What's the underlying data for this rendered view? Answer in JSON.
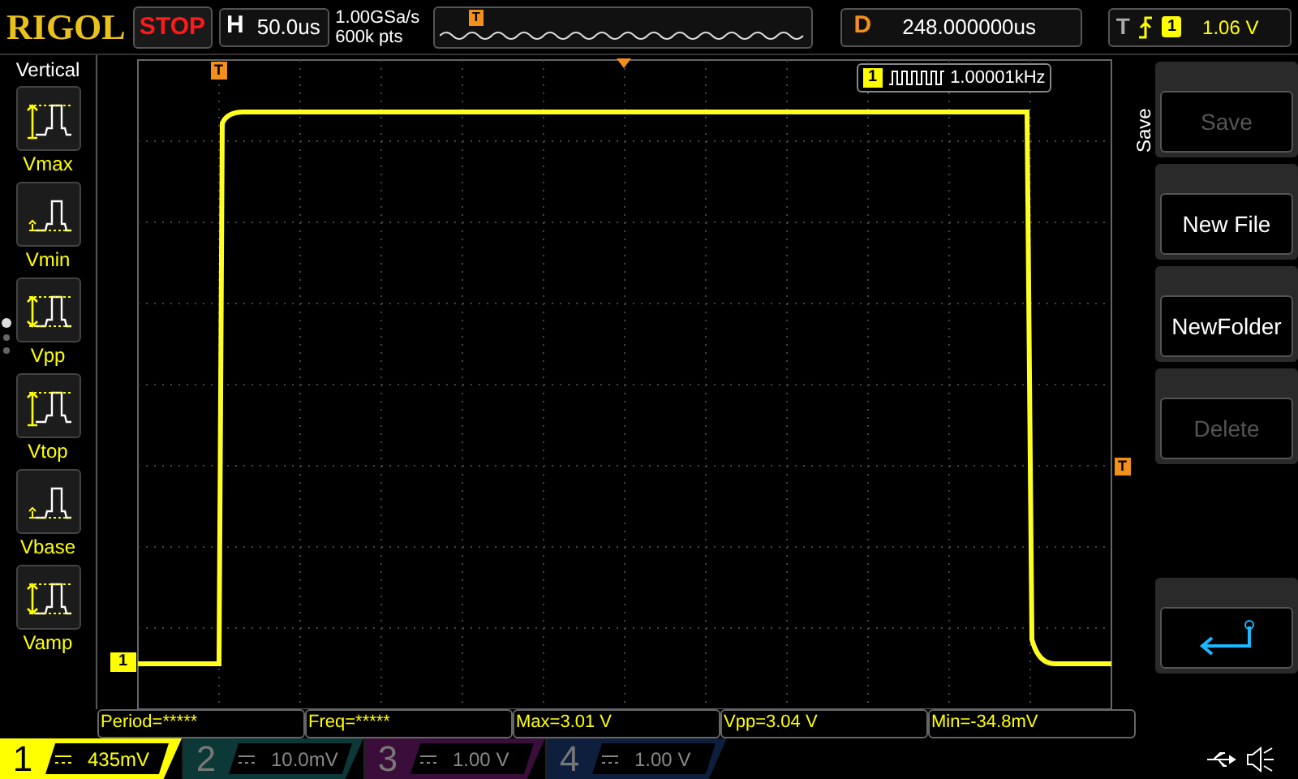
{
  "header": {
    "logo": "RIGOL",
    "run_state": "STOP",
    "horizontal": {
      "label": "H",
      "value": "50.0us"
    },
    "sample_rate": "1.00GSa/s",
    "memory_depth": "600k pts",
    "trigger_position_marker": "T",
    "delay": {
      "label": "D",
      "value": "248.000000us"
    },
    "trigger": {
      "label": "T",
      "channel": "1",
      "level": "1.06 V"
    }
  },
  "sidebar": {
    "title": "Vertical",
    "items": [
      {
        "label": "Vmax",
        "kind": "max"
      },
      {
        "label": "Vmin",
        "kind": "min"
      },
      {
        "label": "Vpp",
        "kind": "pp"
      },
      {
        "label": "Vtop",
        "kind": "max"
      },
      {
        "label": "Vbase",
        "kind": "min"
      },
      {
        "label": "Vamp",
        "kind": "pp"
      }
    ],
    "pages": [
      {
        "selected": true
      },
      {
        "selected": false
      },
      {
        "selected": false
      }
    ]
  },
  "display": {
    "channel_marker": "1",
    "trigger_time_marker": "T",
    "trigger_level_marker": "T",
    "frequency": {
      "channel": "1",
      "value": "1.00001kHz"
    }
  },
  "menu": {
    "title": "Save",
    "buttons": [
      {
        "label": "Save",
        "disabled": true,
        "kind": "text"
      },
      {
        "label": "New File",
        "disabled": false,
        "kind": "text"
      },
      {
        "label": "NewFolder",
        "disabled": false,
        "kind": "text"
      },
      {
        "label": "Delete",
        "disabled": true,
        "kind": "text"
      },
      {
        "kind": "back"
      }
    ]
  },
  "measurements": [
    "Period=*****",
    "Freq=*****",
    "Max=3.01 V",
    "Vpp=3.04 V",
    "Min=-34.8mV"
  ],
  "channels": [
    {
      "number": "1",
      "scale": "435mV",
      "active": true,
      "color": "#ffff00"
    },
    {
      "number": "2",
      "scale": "10.0mV",
      "active": false,
      "color": "#0d3838"
    },
    {
      "number": "3",
      "scale": "1.00 V",
      "active": false,
      "color": "#3a0d3a"
    },
    {
      "number": "4",
      "scale": "1.00 V",
      "active": false,
      "color": "#0d1f3d"
    }
  ]
}
